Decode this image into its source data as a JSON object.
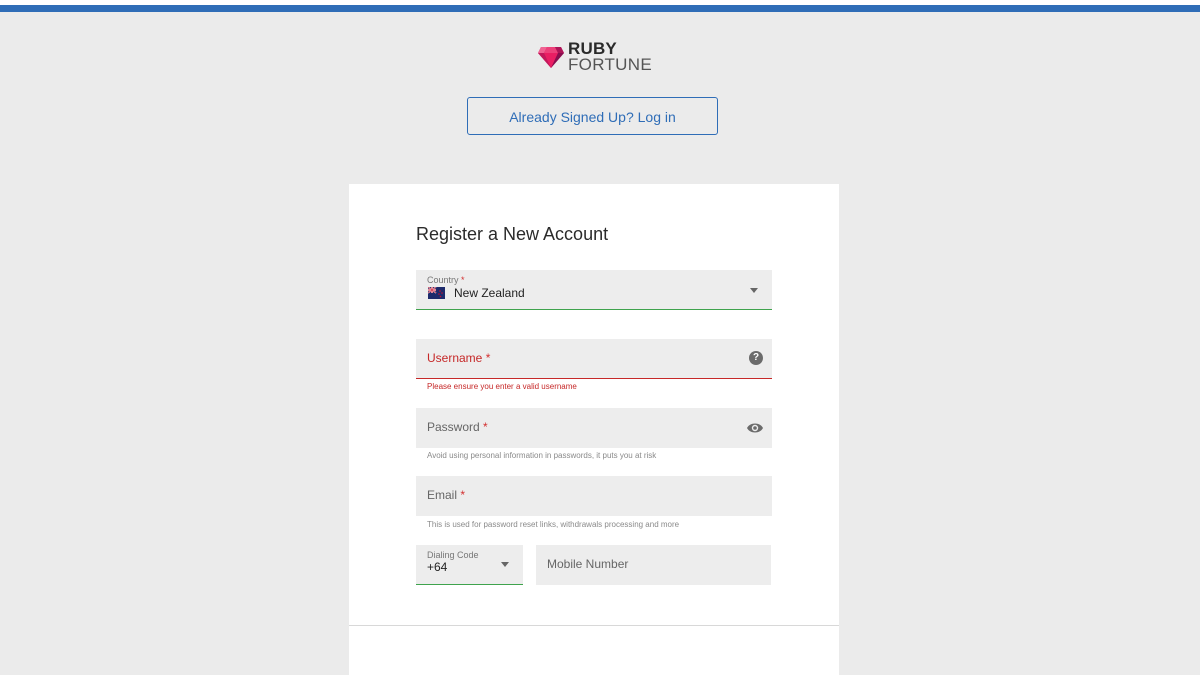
{
  "brand": {
    "logo_line1": "RUBY",
    "logo_line2": "FORTUNE",
    "accent_color": "#2f6db7",
    "gem_color": "#d81b60"
  },
  "header": {
    "login_button_label": "Already Signed Up? Log in"
  },
  "form": {
    "title": "Register a New Account",
    "country": {
      "label": "Country",
      "required_mark": "*",
      "value": "New Zealand",
      "flag_icon": "new-zealand-flag-icon"
    },
    "username": {
      "label": "Username",
      "required_mark": "*",
      "error": "Please ensure you enter a valid username",
      "icon": "help-icon"
    },
    "password": {
      "label": "Password",
      "required_mark": "*",
      "hint": "Avoid using personal information in passwords, it puts you at risk",
      "icon": "eye-icon"
    },
    "email": {
      "label": "Email",
      "required_mark": "*",
      "hint": "This is used for password reset links, withdrawals processing and more"
    },
    "dialing_code": {
      "label": "Dialing Code",
      "value": "+64"
    },
    "mobile": {
      "label": "Mobile Number"
    }
  },
  "colors": {
    "valid": "#3fa34d",
    "error": "#c62828"
  }
}
